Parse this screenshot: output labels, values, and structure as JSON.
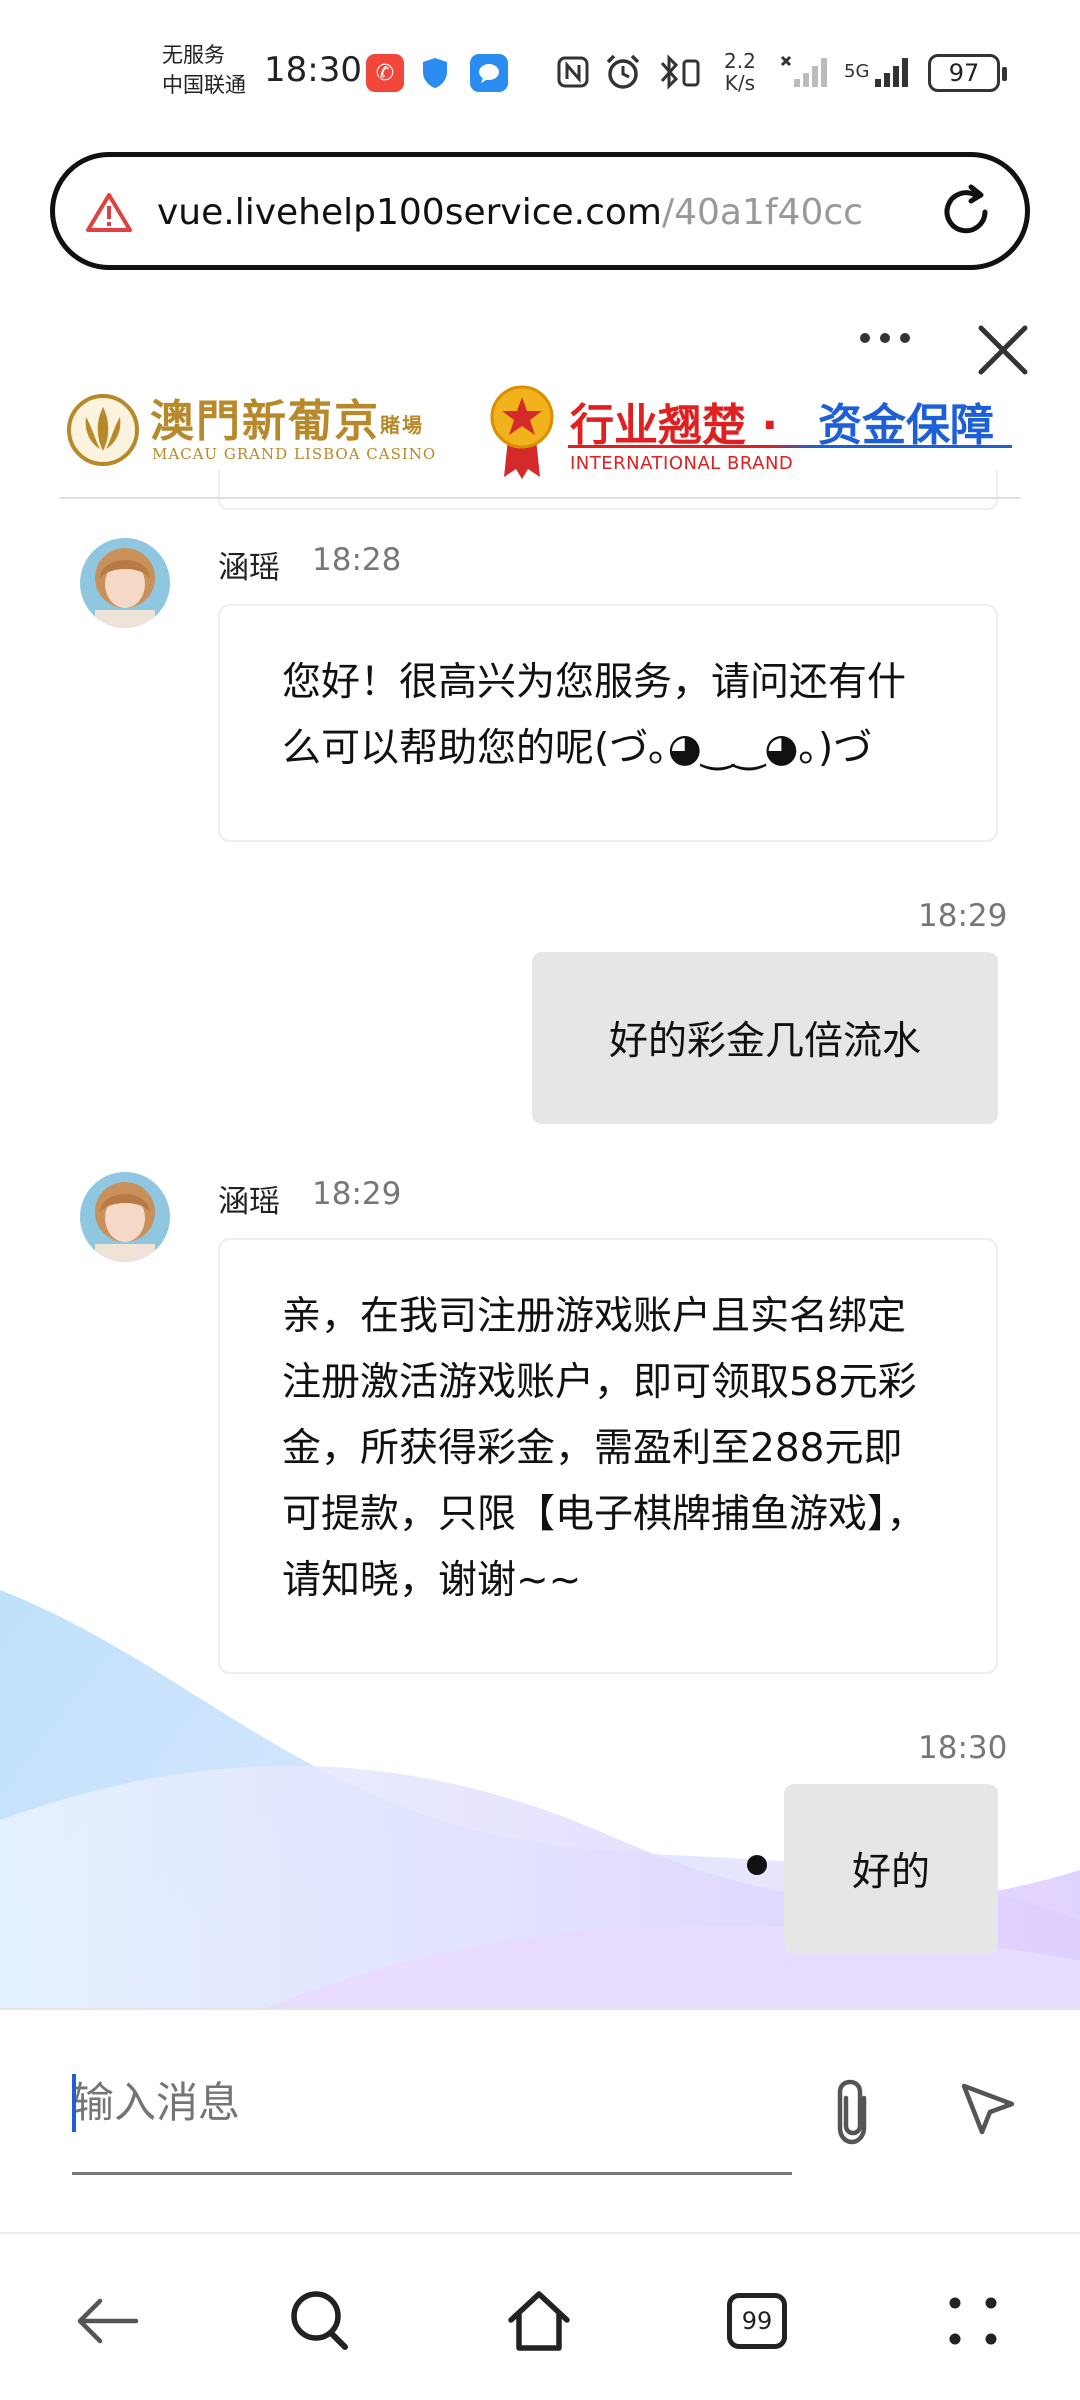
{
  "status_bar": {
    "carrier_line1": "无服务",
    "carrier_line2": "中国联通",
    "time": "18:30",
    "net_speed_value": "2.2",
    "net_speed_unit": "K/s",
    "network": "5G",
    "battery": "97"
  },
  "browser": {
    "url_host": "vue.livehelp100service.com",
    "url_path": "/40a1f40cc",
    "tab_count": "99"
  },
  "header": {
    "brand_cn": "澳門新葡京",
    "brand_tag": "賭場",
    "brand_en": "MACAU GRAND LISBOA CASINO",
    "slogan_red": "行业翘楚 ·",
    "slogan_blue": "资金保障",
    "slogan_en": "INTERNATIONAL BRAND"
  },
  "messages": [
    {
      "direction": "in",
      "sender": "涵瑶",
      "time": "18:28",
      "text": "您好！很高兴为您服务，请问还有什么可以帮助您的呢(づ｡◕‿‿◕｡)づ"
    },
    {
      "direction": "out",
      "time": "18:29",
      "text": "好的彩金几倍流水"
    },
    {
      "direction": "in",
      "sender": "涵瑶",
      "time": "18:29",
      "text": "亲，在我司注册游戏账户且实名绑定注册激活游戏账户，即可领取58元彩金，所获得彩金，需盈利至288元即可提款，只限【电子棋牌捕鱼游戏】，请知晓，谢谢~~"
    },
    {
      "direction": "out",
      "time": "18:30",
      "text": "好的"
    }
  ],
  "composer": {
    "placeholder": "输入消息"
  },
  "icons": {
    "warning": "warning-triangle-icon",
    "reload": "reload-icon",
    "more": "more-dots-icon",
    "close": "close-icon",
    "attach": "paperclip-icon",
    "send": "send-icon",
    "back": "back-arrow-icon",
    "search": "search-icon",
    "home": "home-icon",
    "menu": "menu-dots-icon"
  },
  "colors": {
    "accent_blue": "#1e5fd8",
    "brand_gold": "#b8892a",
    "slogan_red": "#e02020",
    "outgoing_bubble": "#e6e6e6"
  }
}
